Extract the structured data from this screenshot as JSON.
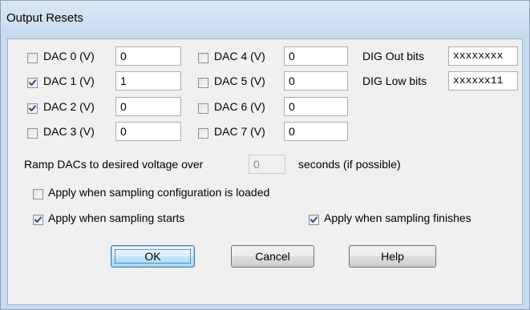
{
  "window": {
    "title": "Output Resets"
  },
  "dacs": [
    {
      "label": "DAC 0 (V)",
      "checked": false,
      "value": "0"
    },
    {
      "label": "DAC 1 (V)",
      "checked": true,
      "value": "1"
    },
    {
      "label": "DAC 2 (V)",
      "checked": true,
      "value": "0"
    },
    {
      "label": "DAC 3 (V)",
      "checked": false,
      "value": "0"
    },
    {
      "label": "DAC 4 (V)",
      "checked": false,
      "value": "0"
    },
    {
      "label": "DAC 5 (V)",
      "checked": false,
      "value": "0"
    },
    {
      "label": "DAC 6 (V)",
      "checked": false,
      "value": "0"
    },
    {
      "label": "DAC 7 (V)",
      "checked": false,
      "value": "0"
    }
  ],
  "dig": {
    "out_label": "DIG Out bits",
    "out_value": "xxxxxxxx",
    "low_label": "DIG Low bits",
    "low_value": "xxxxxx11"
  },
  "ramp": {
    "prefix": "Ramp DACs to desired voltage over",
    "value": "0",
    "suffix": "seconds (if possible)"
  },
  "options": {
    "apply_loaded": {
      "label": "Apply when sampling configuration is loaded",
      "checked": false
    },
    "apply_starts": {
      "label": "Apply when sampling starts",
      "checked": true
    },
    "apply_finishes": {
      "label": "Apply when sampling finishes",
      "checked": true
    }
  },
  "buttons": {
    "ok": "OK",
    "cancel": "Cancel",
    "help": "Help"
  },
  "colors": {
    "check_mark": "#2a4f8a",
    "title_bar": "#c9dcef",
    "dialog_bg": "#f0f0f0"
  }
}
